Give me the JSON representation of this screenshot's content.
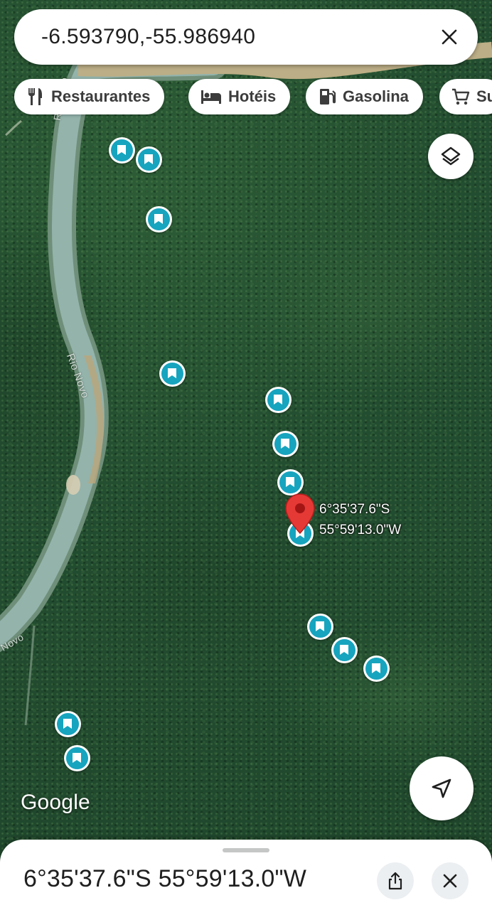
{
  "search": {
    "query": "-6.593790,-55.986940"
  },
  "chips": [
    {
      "label": "Restaurantes",
      "icon": "restaurant-icon"
    },
    {
      "label": "Hotéis",
      "icon": "hotel-icon"
    },
    {
      "label": "Gasolina",
      "icon": "gas-station-icon"
    },
    {
      "label": "Su",
      "icon": "shopping-cart-icon"
    }
  ],
  "map": {
    "type": "satellite",
    "river_labels": [
      "Rio Novo",
      "Rio Novo",
      "Novo"
    ],
    "saved_pin_count": 14,
    "colors": {
      "saved_pin": "#17a4be",
      "marker": "#e53935",
      "forest": "#234d30",
      "river": "#8fb0a8"
    }
  },
  "marker": {
    "lat_label": "6°35'37.6\"S",
    "lng_label": "55°59'13.0\"W"
  },
  "logo": "Google",
  "sheet": {
    "title": "6°35'37.6\"S 55°59'13.0\"W"
  },
  "icons": {
    "layers": "layers-icon",
    "my_location": "navigation-arrow-icon",
    "share": "share-icon",
    "close": "close-icon"
  }
}
